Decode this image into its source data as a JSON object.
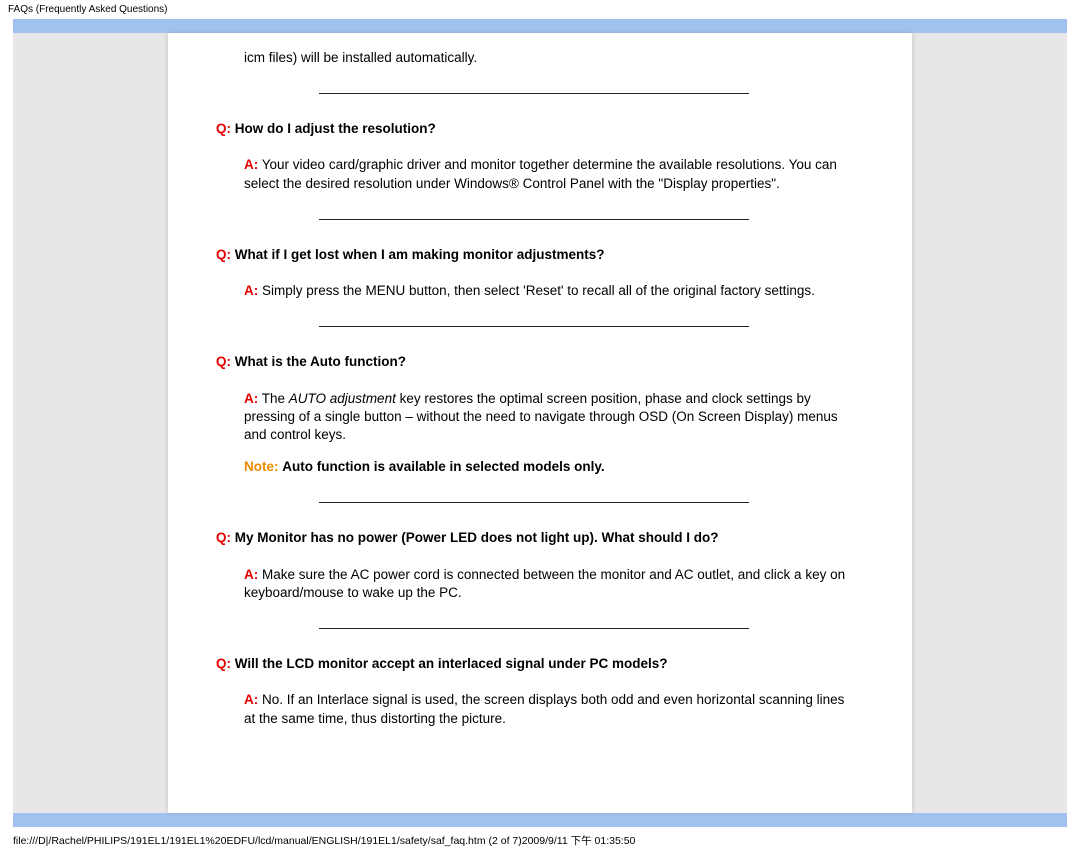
{
  "header_title": "FAQs (Frequently Asked Questions)",
  "top_fragment": "icm files) will be installed automatically.",
  "q_prefix": "Q:",
  "a_prefix": "A:",
  "note_prefix": "Note:",
  "faqs": [
    {
      "q": "How do I adjust the resolution?",
      "a": "Your video card/graphic driver and monitor together determine the available resolutions. You can select the desired resolution under Windows® Control Panel with the \"Display properties\"."
    },
    {
      "q": "What if I get lost when I am making monitor adjustments?",
      "a": "Simply press the MENU button, then select 'Reset' to recall all of the original factory settings."
    },
    {
      "q": "What is the Auto function?",
      "a_pre": "The ",
      "a_em": "AUTO adjustment",
      "a_post": " key restores the optimal screen position, phase and clock settings by pressing of a single button – without the need to navigate through OSD (On Screen Display) menus and control keys.",
      "note": "Auto function is available in selected models only."
    },
    {
      "q": "My Monitor has no power (Power LED does not light up). What should I do?",
      "a": "Make sure the AC power cord is connected between the monitor and AC outlet, and click a key on keyboard/mouse to wake up the PC."
    },
    {
      "q": "Will the LCD monitor accept an interlaced signal under PC models?",
      "a": "No. If an Interlace signal is used, the screen displays both odd and even horizontal scanning lines at the same time, thus distorting the picture."
    }
  ],
  "footer": "file:///D|/Rachel/PHILIPS/191EL1/191EL1%20EDFU/lcd/manual/ENGLISH/191EL1/safety/saf_faq.htm (2 of 7)2009/9/11 下午 01:35:50"
}
